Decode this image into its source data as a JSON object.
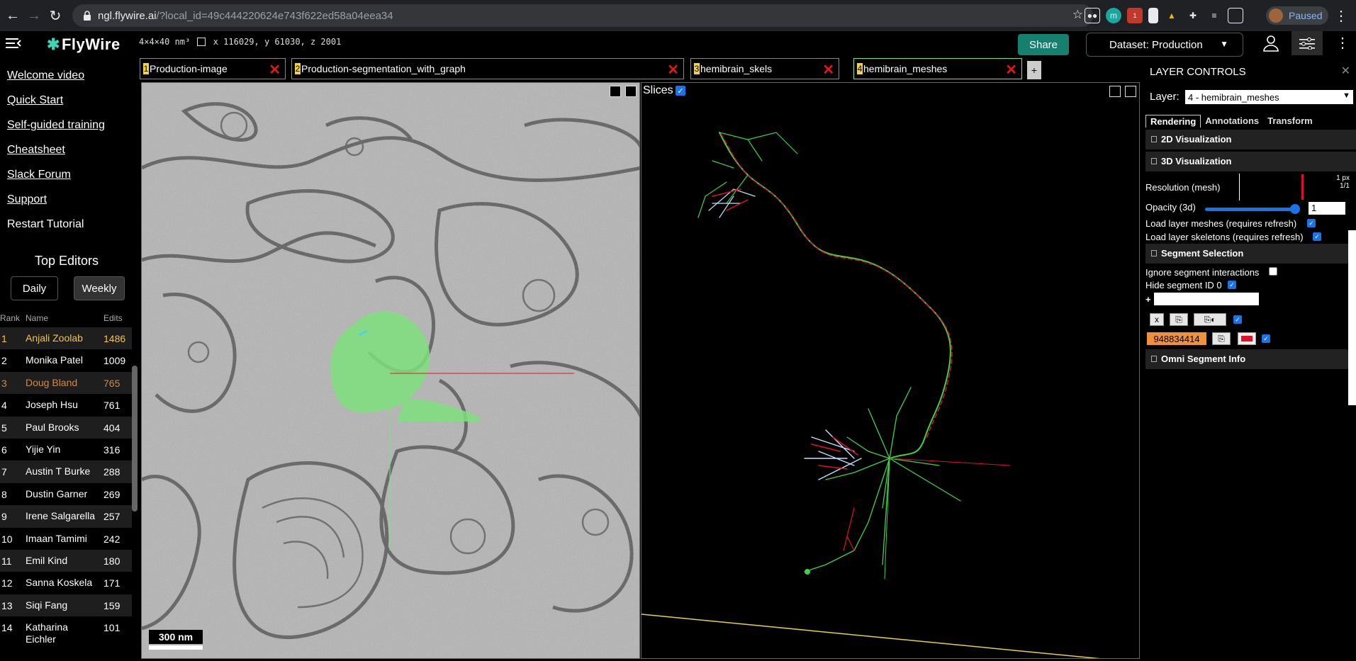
{
  "browser": {
    "url_host": "ngl.flywire.ai",
    "url_path": "/?local_id=49c444220624e743f622ed58a04eea34",
    "profile_status": "Paused"
  },
  "app": {
    "logo_text": "FlyWire",
    "voxel_size": "4×4×40 nm³",
    "coordinates": "x 116029, y 61030, z 2001",
    "share_label": "Share",
    "dataset_label": "Dataset: Production"
  },
  "sidebar": {
    "links": [
      "Welcome video",
      "Quick Start",
      "Self-guided training",
      "Cheatsheet",
      "Slack Forum",
      "Support"
    ],
    "restart_label": "Restart Tutorial",
    "top_editors_title": "Top Editors",
    "daily_label": "Daily",
    "weekly_label": "Weekly",
    "columns": {
      "rank": "Rank",
      "name": "Name",
      "edits": "Edits"
    },
    "rows": [
      {
        "rank": "1",
        "name": "Anjali Zoolab",
        "edits": "1486"
      },
      {
        "rank": "2",
        "name": "Monika Patel",
        "edits": "1009"
      },
      {
        "rank": "3",
        "name": "Doug Bland",
        "edits": "765"
      },
      {
        "rank": "4",
        "name": "Joseph Hsu",
        "edits": "761"
      },
      {
        "rank": "5",
        "name": "Paul Brooks",
        "edits": "404"
      },
      {
        "rank": "6",
        "name": "Yijie Yin",
        "edits": "316"
      },
      {
        "rank": "7",
        "name": "Austin T Burke",
        "edits": "288"
      },
      {
        "rank": "8",
        "name": "Dustin Garner",
        "edits": "269"
      },
      {
        "rank": "9",
        "name": "Irene Salgarella",
        "edits": "257"
      },
      {
        "rank": "10",
        "name": "Imaan Tamimi",
        "edits": "242"
      },
      {
        "rank": "11",
        "name": "Emil Kind",
        "edits": "180"
      },
      {
        "rank": "12",
        "name": "Sanna Koskela",
        "edits": "171"
      },
      {
        "rank": "13",
        "name": "Siqi Fang",
        "edits": "159"
      },
      {
        "rank": "14",
        "name": "Katharina Eichler",
        "edits": "101"
      }
    ]
  },
  "layers": {
    "tabs": [
      {
        "num": "1",
        "name": "Production-image"
      },
      {
        "num": "2",
        "name": "Production-segmentation_with_graph"
      },
      {
        "num": "3",
        "name": "hemibrain_skels"
      },
      {
        "num": "4",
        "name": "hemibrain_meshes"
      }
    ],
    "add_label": "+"
  },
  "viewer": {
    "slices_label": "Slices",
    "scalebar_label": "300 nm"
  },
  "layer_controls": {
    "title": "LAYER CONTROLS",
    "layer_label": "Layer:",
    "layer_selected": "4 - hemibrain_meshes",
    "tabs": [
      "Rendering",
      "Annotations",
      "Transform"
    ],
    "section_2d": "2D Visualization",
    "section_3d": "3D Visualization",
    "resolution_label": "Resolution (mesh)",
    "resolution_value_a": "1 px",
    "resolution_value_b": "1/1",
    "opacity_label": "Opacity (3d)",
    "opacity_value": "1",
    "load_meshes_label": "Load layer meshes (requires refresh)",
    "load_skeletons_label": "Load layer skeletons (requires refresh)",
    "section_segment": "Segment Selection",
    "ignore_label": "Ignore segment interactions",
    "hide_label": "Hide segment ID 0",
    "add_segment_prefix": "+",
    "clear_label": "x",
    "segment_id": "948834414",
    "section_omni": "Omni Segment Info"
  },
  "colors": {
    "accent": "#16806e",
    "layer_num": "#f4d33b",
    "close_red": "#e01818",
    "mesh_green": "#7ee07e",
    "gold": "#f5c242",
    "bronze": "#d48a3a"
  }
}
